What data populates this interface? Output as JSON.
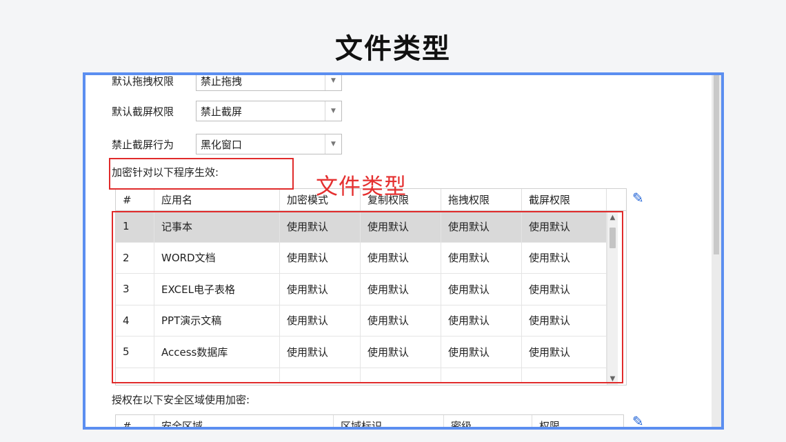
{
  "slide_title": "文件类型",
  "settings": [
    {
      "label": "默认拖拽权限",
      "value": "禁止拖拽"
    },
    {
      "label": "默认截屏权限",
      "value": "禁止截屏"
    },
    {
      "label": "禁止截屏行为",
      "value": "黑化窗口"
    }
  ],
  "encrypt_section_label": "加密针对以下程序生效:",
  "annotation_text": "文件类型",
  "program_table": {
    "columns": [
      "#",
      "应用名",
      "加密模式",
      "复制权限",
      "拖拽权限",
      "截屏权限"
    ],
    "rows": [
      [
        "1",
        "记事本",
        "使用默认",
        "使用默认",
        "使用默认",
        "使用默认"
      ],
      [
        "2",
        "WORD文档",
        "使用默认",
        "使用默认",
        "使用默认",
        "使用默认"
      ],
      [
        "3",
        "EXCEL电子表格",
        "使用默认",
        "使用默认",
        "使用默认",
        "使用默认"
      ],
      [
        "4",
        "PPT演示文稿",
        "使用默认",
        "使用默认",
        "使用默认",
        "使用默认"
      ],
      [
        "5",
        "Access数据库",
        "使用默认",
        "使用默认",
        "使用默认",
        "使用默认"
      ]
    ],
    "selected_row": 0
  },
  "zone_section_label": "授权在以下安全区域使用加密:",
  "zone_table": {
    "columns": [
      "#",
      "安全区域",
      "区域标识",
      "密级",
      "权限"
    ]
  },
  "colors": {
    "frame_border": "#5b8ef0",
    "annotation_red": "#e02a2a",
    "edit_icon_blue": "#1f62d6",
    "selected_row_bg": "#d9d9d9"
  },
  "icons": {
    "edit": "pencil-icon",
    "dropdown": "chevron-down-icon",
    "scroll_up": "chevron-up-icon",
    "scroll_down": "chevron-down-icon"
  }
}
